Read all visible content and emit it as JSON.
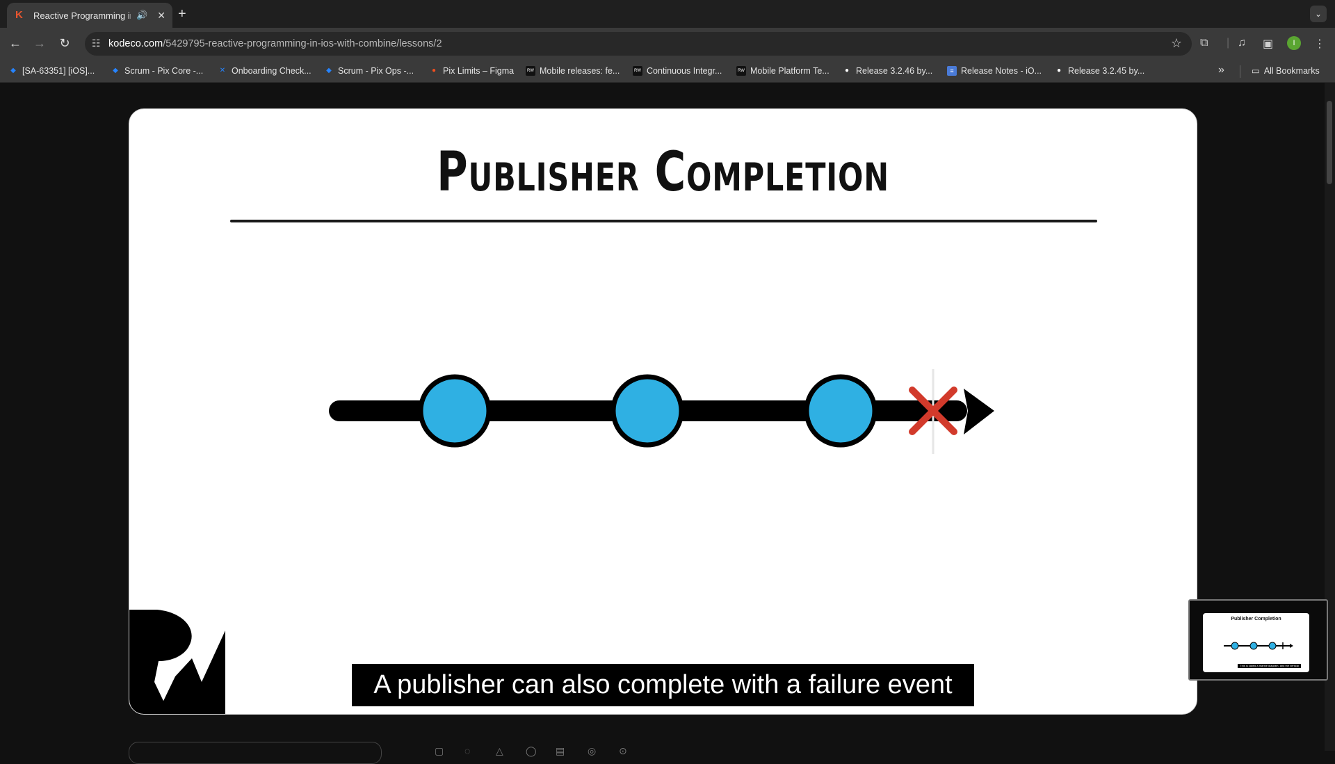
{
  "browser": {
    "tab": {
      "favicon": "K",
      "title": "Reactive Programming in iOS with Combine",
      "audio_icon": "speaker-icon",
      "close_icon": "close-icon"
    },
    "new_tab_glyph": "+",
    "tab_menu_glyph": "⌄",
    "url_host": "kodeco.com",
    "url_path": "/5429795-reactive-programming-in-ios-with-combine/lessons/2",
    "profile_initial": "I"
  },
  "bookmarks": [
    {
      "label": "[SA-63351] [iOS]...",
      "icon": "jira-icon"
    },
    {
      "label": "Scrum - Pix Core -...",
      "icon": "jira-icon"
    },
    {
      "label": "Onboarding Check...",
      "icon": "confluence-icon"
    },
    {
      "label": "Scrum - Pix Ops -...",
      "icon": "jira-icon"
    },
    {
      "label": "Pix Limits – Figma",
      "icon": "figma-icon"
    },
    {
      "label": "Mobile releases: fe...",
      "icon": "rw-icon"
    },
    {
      "label": "Continuous Integr...",
      "icon": "rw-icon"
    },
    {
      "label": "Mobile Platform Te...",
      "icon": "rw-icon"
    },
    {
      "label": "Release 3.2.46 by...",
      "icon": "github-icon"
    },
    {
      "label": "Release Notes - iO...",
      "icon": "docs-icon"
    },
    {
      "label": "Release 3.2.45 by...",
      "icon": "github-icon"
    }
  ],
  "bookmarks_more": "»",
  "all_bookmarks": "All Bookmarks",
  "slide": {
    "title": "Publisher Completion",
    "diagram": {
      "events": 3,
      "event_color": "#2fb0e3",
      "failure_marker": "x-mark",
      "failure_color": "#d23a2b"
    }
  },
  "caption": "A publisher can also complete with a failure event",
  "pip": {
    "title": "Publisher Completion",
    "caption": "This is called a marble diagram, and the vertical bar"
  }
}
